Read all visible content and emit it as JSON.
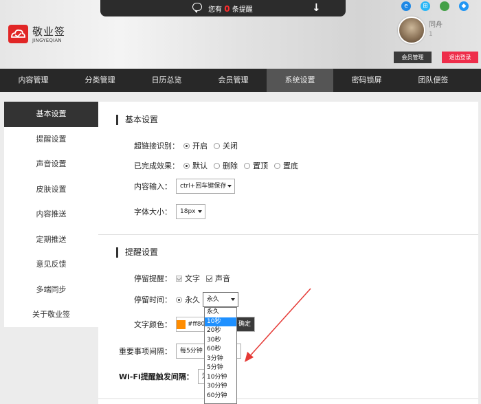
{
  "notice": {
    "prefix": "您有",
    "count": "0",
    "suffix": "条提醒",
    "arrow": "↓"
  },
  "logo": {
    "name": "敬业签",
    "sub": "JINGYEQIAN"
  },
  "os_icons": [
    {
      "name": "ie",
      "glyph": "e",
      "color": "#1e88e5"
    },
    {
      "name": "windows",
      "glyph": "⊞",
      "color": "#29b6f6"
    },
    {
      "name": "apple",
      "glyph": "",
      "color": "#43a047"
    },
    {
      "name": "android",
      "glyph": "◆",
      "color": "#2196f3"
    }
  ],
  "user": {
    "name": "同舟",
    "id": "1"
  },
  "header_buttons": {
    "member": "会员管理",
    "logout": "退出登录"
  },
  "nav": [
    "内容管理",
    "分类管理",
    "日历总览",
    "会员管理",
    "系统设置",
    "密码锁屏",
    "团队便签"
  ],
  "sidebar": [
    "基本设置",
    "提醒设置",
    "声音设置",
    "皮肤设置",
    "内容推送",
    "定期推送",
    "意见反馈",
    "多端同步",
    "关于敬业签"
  ],
  "basic": {
    "title": "基本设置",
    "hyperlink": {
      "label": "超链接识别：",
      "on": "开启",
      "off": "关闭"
    },
    "done": {
      "label": "已完成效果：",
      "opts": [
        "默认",
        "删除",
        "置顶",
        "置底"
      ]
    },
    "input": {
      "label": "内容输入：",
      "value": "ctrl+回车键保存"
    },
    "font": {
      "label": "字体大小：",
      "value": "18px"
    }
  },
  "remind": {
    "title": "提醒设置",
    "stay": {
      "label": "停留提醒：",
      "text": "文字",
      "sound": "声音"
    },
    "time": {
      "label": "停留时间：",
      "radio": "永久",
      "value": "永久"
    },
    "color": {
      "label": "文字颜色：",
      "value": "#ff800",
      "confirm": "确定"
    },
    "interval": {
      "label": "重要事项间隔：",
      "value": "每5分钟"
    },
    "wifi": {
      "label": "Wi-Fi提醒触发间隔：",
      "value": "无"
    }
  },
  "dropdown": [
    "永久",
    "10秒",
    "20秒",
    "30秒",
    "60秒",
    "3分钟",
    "5分钟",
    "10分钟",
    "30分钟",
    "60分钟"
  ],
  "colors": {
    "accent": "#e12626",
    "logout": "#ee2d4a",
    "nav_bg": "#282828",
    "highlight": "#1e90ff",
    "swatch": "#ff8c00"
  }
}
